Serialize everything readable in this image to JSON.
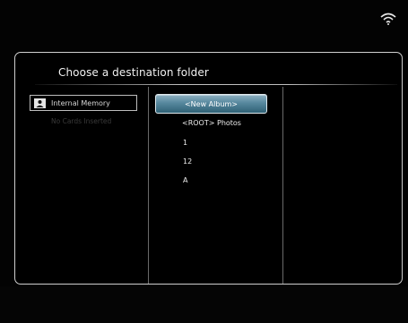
{
  "status": {
    "wifi_icon": "wifi-icon"
  },
  "dialog": {
    "title": "Choose a destination folder"
  },
  "sources": {
    "internal_memory": {
      "label": "Internal Memory",
      "icon": "memory-card-icon"
    },
    "no_cards_label": "No Cards Inserted"
  },
  "folders": {
    "selected": "<New Album>",
    "items": [
      "<ROOT> Photos",
      "1",
      "12",
      "A"
    ]
  },
  "colors": {
    "background": "#000000",
    "selected_highlight": "#57889e",
    "frame_border": "#cfcfcf"
  }
}
